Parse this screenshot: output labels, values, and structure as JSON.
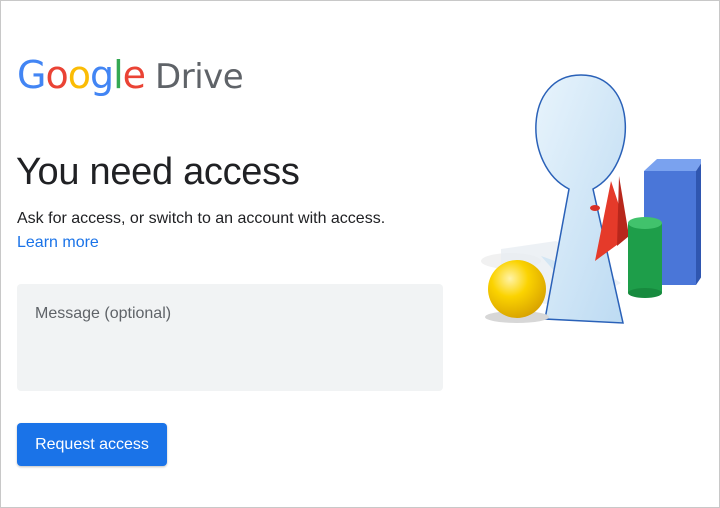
{
  "logo": {
    "google_letters": [
      {
        "ch": "G",
        "color": "#4285F4"
      },
      {
        "ch": "o",
        "color": "#EA4335"
      },
      {
        "ch": "o",
        "color": "#FBBC05"
      },
      {
        "ch": "g",
        "color": "#4285F4"
      },
      {
        "ch": "l",
        "color": "#34A853"
      },
      {
        "ch": "e",
        "color": "#EA4335"
      }
    ],
    "product": "Drive"
  },
  "page": {
    "title": "You need access",
    "subtitle": "Ask for access, or switch to an account with access.",
    "learn_more": "Learn more"
  },
  "form": {
    "message_placeholder": "Message (optional)",
    "message_value": "",
    "submit_label": "Request access"
  },
  "colors": {
    "accent": "#1a73e8",
    "field_bg": "#f1f3f4"
  },
  "illustration": {
    "icon": "keyhole-mirror-shapes-illustration"
  }
}
